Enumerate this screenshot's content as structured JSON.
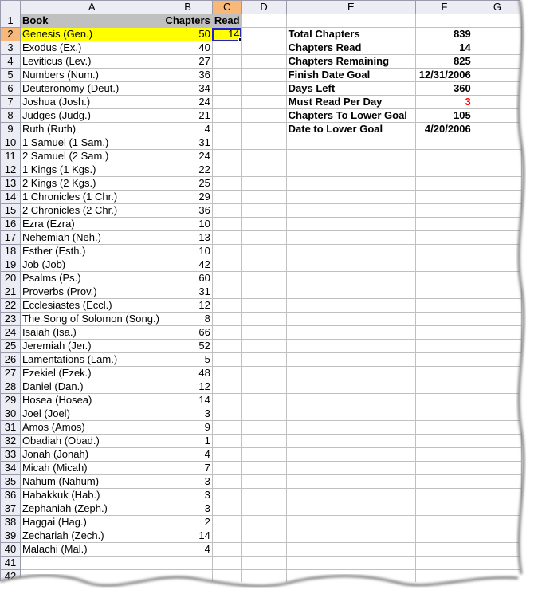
{
  "columns": [
    "A",
    "B",
    "C",
    "D",
    "E",
    "F",
    "G"
  ],
  "selected_column": "C",
  "selected_row": 2,
  "header_row": {
    "book": "Book",
    "chapters": "Chapters",
    "read": "Read"
  },
  "books": [
    {
      "row": 2,
      "name": "Genesis (Gen.)",
      "chapters": "50",
      "read": "14"
    },
    {
      "row": 3,
      "name": "Exodus (Ex.)",
      "chapters": "40",
      "read": ""
    },
    {
      "row": 4,
      "name": "Leviticus (Lev.)",
      "chapters": "27",
      "read": ""
    },
    {
      "row": 5,
      "name": "Numbers (Num.)",
      "chapters": "36",
      "read": ""
    },
    {
      "row": 6,
      "name": "Deuteronomy (Deut.)",
      "chapters": "34",
      "read": ""
    },
    {
      "row": 7,
      "name": "Joshua (Josh.)",
      "chapters": "24",
      "read": ""
    },
    {
      "row": 8,
      "name": "Judges (Judg.)",
      "chapters": "21",
      "read": ""
    },
    {
      "row": 9,
      "name": "Ruth (Ruth)",
      "chapters": "4",
      "read": ""
    },
    {
      "row": 10,
      "name": "1 Samuel (1 Sam.)",
      "chapters": "31",
      "read": ""
    },
    {
      "row": 11,
      "name": "2 Samuel (2 Sam.)",
      "chapters": "24",
      "read": ""
    },
    {
      "row": 12,
      "name": "1 Kings (1 Kgs.)",
      "chapters": "22",
      "read": ""
    },
    {
      "row": 13,
      "name": "2 Kings (2 Kgs.)",
      "chapters": "25",
      "read": ""
    },
    {
      "row": 14,
      "name": "1 Chronicles (1 Chr.)",
      "chapters": "29",
      "read": ""
    },
    {
      "row": 15,
      "name": "2 Chronicles (2 Chr.)",
      "chapters": "36",
      "read": ""
    },
    {
      "row": 16,
      "name": "Ezra (Ezra)",
      "chapters": "10",
      "read": ""
    },
    {
      "row": 17,
      "name": "Nehemiah (Neh.)",
      "chapters": "13",
      "read": ""
    },
    {
      "row": 18,
      "name": "Esther (Esth.)",
      "chapters": "10",
      "read": ""
    },
    {
      "row": 19,
      "name": "Job (Job)",
      "chapters": "42",
      "read": ""
    },
    {
      "row": 20,
      "name": "Psalms (Ps.)",
      "chapters": "60",
      "read": ""
    },
    {
      "row": 21,
      "name": "Proverbs (Prov.)",
      "chapters": "31",
      "read": ""
    },
    {
      "row": 22,
      "name": "Ecclesiastes (Eccl.)",
      "chapters": "12",
      "read": ""
    },
    {
      "row": 23,
      "name": "The Song of Solomon (Song.)",
      "chapters": "8",
      "read": ""
    },
    {
      "row": 24,
      "name": "Isaiah (Isa.)",
      "chapters": "66",
      "read": ""
    },
    {
      "row": 25,
      "name": "Jeremiah (Jer.)",
      "chapters": "52",
      "read": ""
    },
    {
      "row": 26,
      "name": "Lamentations (Lam.)",
      "chapters": "5",
      "read": ""
    },
    {
      "row": 27,
      "name": "Ezekiel (Ezek.)",
      "chapters": "48",
      "read": ""
    },
    {
      "row": 28,
      "name": "Daniel (Dan.)",
      "chapters": "12",
      "read": ""
    },
    {
      "row": 29,
      "name": "Hosea (Hosea)",
      "chapters": "14",
      "read": ""
    },
    {
      "row": 30,
      "name": "Joel (Joel)",
      "chapters": "3",
      "read": ""
    },
    {
      "row": 31,
      "name": "Amos (Amos)",
      "chapters": "9",
      "read": ""
    },
    {
      "row": 32,
      "name": "Obadiah (Obad.)",
      "chapters": "1",
      "read": ""
    },
    {
      "row": 33,
      "name": "Jonah (Jonah)",
      "chapters": "4",
      "read": ""
    },
    {
      "row": 34,
      "name": "Micah (Micah)",
      "chapters": "7",
      "read": ""
    },
    {
      "row": 35,
      "name": "Nahum (Nahum)",
      "chapters": "3",
      "read": ""
    },
    {
      "row": 36,
      "name": "Habakkuk (Hab.)",
      "chapters": "3",
      "read": ""
    },
    {
      "row": 37,
      "name": "Zephaniah (Zeph.)",
      "chapters": "3",
      "read": ""
    },
    {
      "row": 38,
      "name": "Haggai (Hag.)",
      "chapters": "2",
      "read": ""
    },
    {
      "row": 39,
      "name": "Zechariah (Zech.)",
      "chapters": "14",
      "read": ""
    },
    {
      "row": 40,
      "name": "Malachi (Mal.)",
      "chapters": "4",
      "read": ""
    }
  ],
  "empty_rows": [
    41,
    42
  ],
  "summary": [
    {
      "row": 2,
      "label": "Total Chapters",
      "value": "839",
      "color": "#000000"
    },
    {
      "row": 3,
      "label": "Chapters Read",
      "value": "14",
      "color": "#000000"
    },
    {
      "row": 4,
      "label": "Chapters Remaining",
      "value": "825",
      "color": "#000000"
    },
    {
      "row": 5,
      "label": "Finish Date Goal",
      "value": "12/31/2006",
      "color": "#000000"
    },
    {
      "row": 6,
      "label": "Days Left",
      "value": "360",
      "color": "#000000"
    },
    {
      "row": 7,
      "label": "Must Read Per Day",
      "value": "3",
      "color": "#ff0000"
    },
    {
      "row": 8,
      "label": "Chapters To Lower Goal",
      "value": "105",
      "color": "#000000"
    },
    {
      "row": 9,
      "label": "Date to Lower Goal",
      "value": "4/20/2006",
      "color": "#000000"
    }
  ],
  "colors": {
    "highlight_row": "#ffff00",
    "selected_header": "#f8b878",
    "header_fill": "#c0c0c0",
    "active_cell_border": "#2020d0"
  }
}
